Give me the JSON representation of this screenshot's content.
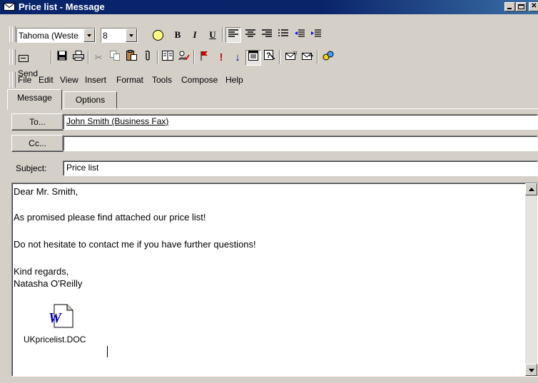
{
  "window": {
    "title": "Price list - Message"
  },
  "format_toolbar": {
    "font": "Tahoma (Weste",
    "size": "8"
  },
  "standard_toolbar": {
    "send_label": "Send"
  },
  "menu": [
    {
      "name": "menu-file",
      "label": "File"
    },
    {
      "name": "menu-edit",
      "label": "Edit"
    },
    {
      "name": "menu-view",
      "label": "View"
    },
    {
      "name": "menu-insert",
      "label": "Insert"
    },
    {
      "name": "menu-format",
      "label": "Format"
    },
    {
      "name": "menu-tools",
      "label": "Tools"
    },
    {
      "name": "menu-compose",
      "label": "Compose"
    },
    {
      "name": "menu-help",
      "label": "Help"
    }
  ],
  "tabs": {
    "message": "Message",
    "options": "Options"
  },
  "header": {
    "to_button": "To...",
    "to_value": "John Smith (Business Fax)",
    "cc_button": "Cc...",
    "cc_value": "",
    "subject_label": "Subject:",
    "subject_value": "Price list"
  },
  "body": {
    "lines": [
      "Dear Mr. Smith,",
      "As promised please find attached our price list!",
      "Do not hesitate to contact me if you have further questions!",
      "Kind regards,",
      "Natasha O'Reilly"
    ]
  },
  "attachment": {
    "filename": "UKpricelist.DOC",
    "icon": "word-document-icon"
  },
  "colors": {
    "titlebar": "#0a246a",
    "face": "#d4d0c8",
    "priority_high": "#e00000",
    "priority_low": "#0000c0"
  }
}
